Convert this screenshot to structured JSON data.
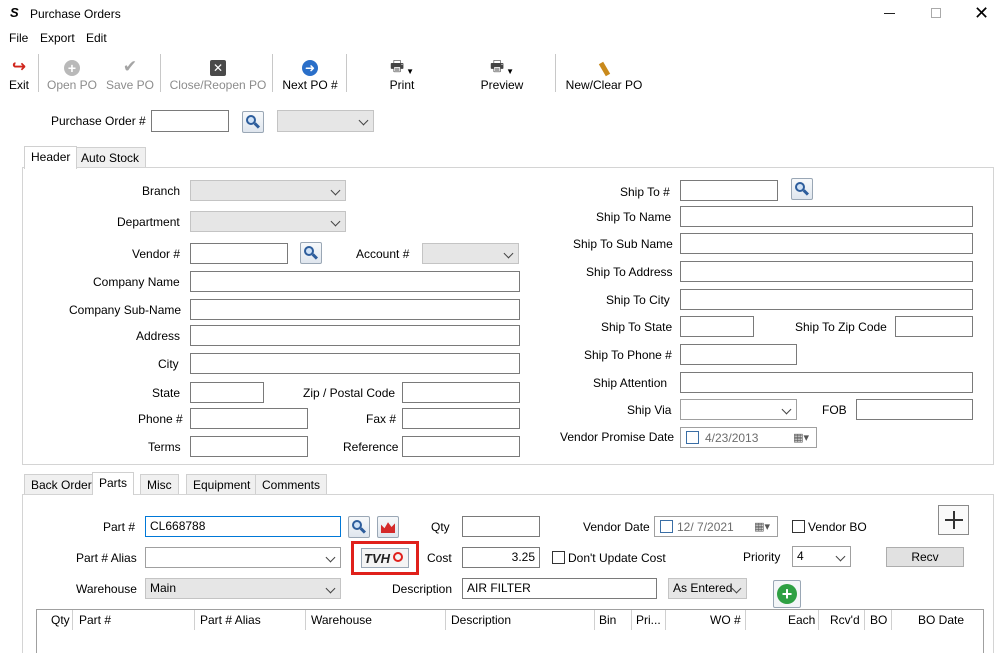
{
  "window": {
    "title": "Purchase Orders"
  },
  "menu": {
    "file": "File",
    "export": "Export",
    "edit": "Edit"
  },
  "toolbar": {
    "exit": "Exit",
    "open_po": "Open PO",
    "save_po": "Save PO",
    "close_reopen_po": "Close/Reopen PO",
    "next_po": "Next PO #",
    "print": "Print",
    "preview": "Preview",
    "new_clear_po": "New/Clear PO"
  },
  "po_search": {
    "label": "Purchase Order #",
    "value": ""
  },
  "header_tabs": [
    "Header",
    "Auto Stock"
  ],
  "header": {
    "branch_label": "Branch",
    "department_label": "Department",
    "vendor_label": "Vendor #",
    "account_label": "Account #",
    "company_name_label": "Company Name",
    "company_sub_name_label": "Company Sub-Name",
    "address_label": "Address",
    "city_label": "City",
    "state_label": "State",
    "zip_label": "Zip / Postal Code",
    "phone_label": "Phone #",
    "fax_label": "Fax #",
    "terms_label": "Terms",
    "reference_label": "Reference",
    "ship_to_label": "Ship To #",
    "ship_to_name_label": "Ship To Name",
    "ship_to_sub_name_label": "Ship To Sub Name",
    "ship_to_address_label": "Ship To Address",
    "ship_to_city_label": "Ship To City",
    "ship_to_state_label": "Ship To State",
    "ship_to_zip_label": "Ship To Zip Code",
    "ship_to_phone_label": "Ship To Phone #",
    "ship_attention_label": "Ship Attention",
    "ship_via_label": "Ship Via",
    "fob_label": "FOB",
    "vendor_promise_date_label": "Vendor Promise Date",
    "vendor_promise_date": "4/23/2013"
  },
  "detail_tabs": [
    "Back Order",
    "Parts",
    "Misc",
    "Equipment",
    "Comments"
  ],
  "parts": {
    "part_label": "Part #",
    "part_value": "CL668788",
    "alias_label": "Part # Alias",
    "alias_value": "",
    "warehouse_label": "Warehouse",
    "warehouse_value": "Main",
    "qty_label": "Qty",
    "qty_value": "",
    "cost_label": "Cost",
    "cost_value": "3.25",
    "description_label": "Description",
    "description_value": "AIR FILTER",
    "entry_mode": "As Entered",
    "vendor_date_label": "Vendor Date",
    "vendor_date": "12/ 7/2021",
    "vendor_bo_label": "Vendor BO",
    "dont_update_cost_label": "Don't Update Cost",
    "priority_label": "Priority",
    "priority_value": "4",
    "recv_button": "Recv",
    "tvh_label": "TVH"
  },
  "grid": {
    "columns": [
      "Qty",
      "Part #",
      "Part # Alias",
      "Warehouse",
      "Description",
      "Bin",
      "Pri...",
      "WO #",
      "Each",
      "Rcv'd",
      "BO",
      "BO Date"
    ]
  },
  "colors": {
    "accent": "#0078d7",
    "highlight_red": "#e0201b",
    "green": "#2ea043"
  }
}
